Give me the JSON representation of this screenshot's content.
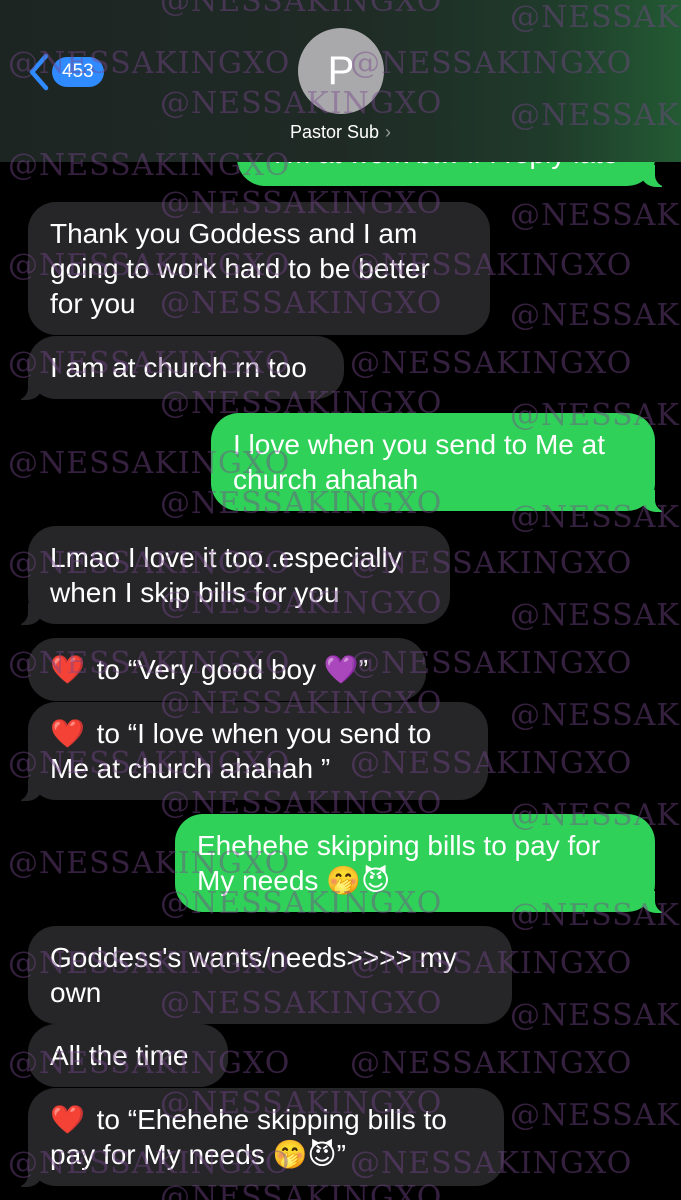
{
  "header": {
    "back_count": "453",
    "avatar_initial": "P",
    "contact_name": "Pastor Sub",
    "chevron": "›"
  },
  "messages": [
    {
      "dir": "out",
      "text": "I'm at work btw if I reply late"
    },
    {
      "dir": "in",
      "text": "Thank you Goddess and I am going to work hard to be better for you"
    },
    {
      "dir": "in",
      "text": "I am at church rn too"
    },
    {
      "dir": "out",
      "text": "I love when you send to Me at church ahahah"
    },
    {
      "dir": "in",
      "text": "Lmao I love it too..especially when I skip bills for you"
    },
    {
      "dir": "in",
      "heart": "❤️",
      "text": "to “Very good boy 💜”"
    },
    {
      "dir": "in",
      "heart": "❤️",
      "text": "to “I love when you send to Me at church ahahah ”"
    },
    {
      "dir": "out",
      "text": "Ehehehe skipping bills to pay for My needs 🤭😈"
    },
    {
      "dir": "in",
      "text": "Goddess's wants/needs>>>> my own"
    },
    {
      "dir": "in",
      "text": "All the time"
    },
    {
      "dir": "in",
      "heart": "❤️",
      "text": "to “Ehehehe skipping bills to pay for My needs 🤭😈”"
    }
  ],
  "watermark": "@NESSAKINGXO",
  "colors": {
    "incoming_bubble": "#262628",
    "outgoing_bubble": "#30d158",
    "badge": "#2f8bff",
    "watermark": "#78468c"
  }
}
